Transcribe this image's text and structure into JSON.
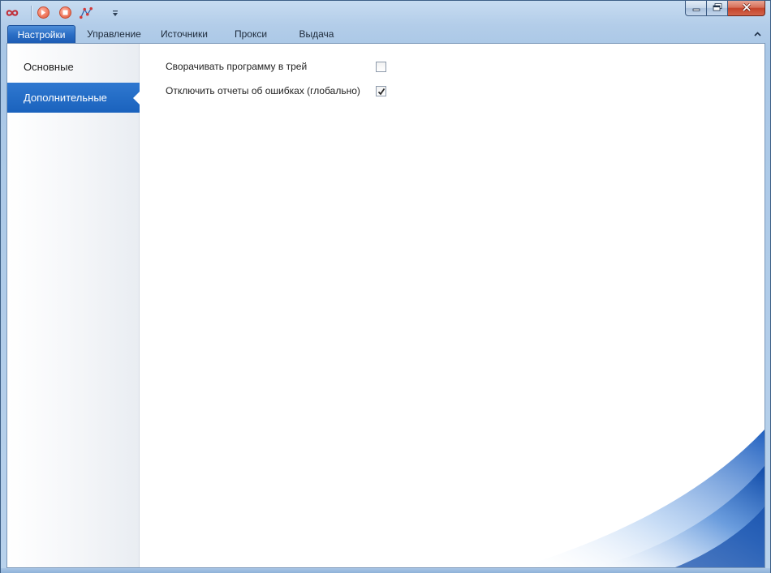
{
  "window": {
    "title": "",
    "quick_access": {
      "icons": [
        "infinity-logo-icon",
        "play-icon",
        "stop-icon",
        "network-graph-icon",
        "customize-quick-access-icon"
      ]
    },
    "caption_buttons": [
      "minimize-icon",
      "maximize-icon",
      "close-icon"
    ]
  },
  "ribbon": {
    "tabs": [
      {
        "label": "Настройки",
        "active": true
      },
      {
        "label": "Управление",
        "active": false
      },
      {
        "label": "Источники",
        "active": false
      },
      {
        "label": "Прокси",
        "active": false
      },
      {
        "label": "Выдача",
        "active": false
      }
    ],
    "collapse_icon": "chevron-up-icon"
  },
  "sidebar": {
    "items": [
      {
        "label": "Основные",
        "active": false
      },
      {
        "label": "Дополнительные",
        "active": true
      }
    ]
  },
  "settings": {
    "items": [
      {
        "label": "Сворачивать программу в трей",
        "checked": false
      },
      {
        "label": "Отключить отчеты об ошибках (глобально)",
        "checked": true
      }
    ]
  },
  "colors": {
    "accent": "#1d62bd",
    "window_frame": "#b3cde9",
    "close_button": "#c5432a"
  }
}
